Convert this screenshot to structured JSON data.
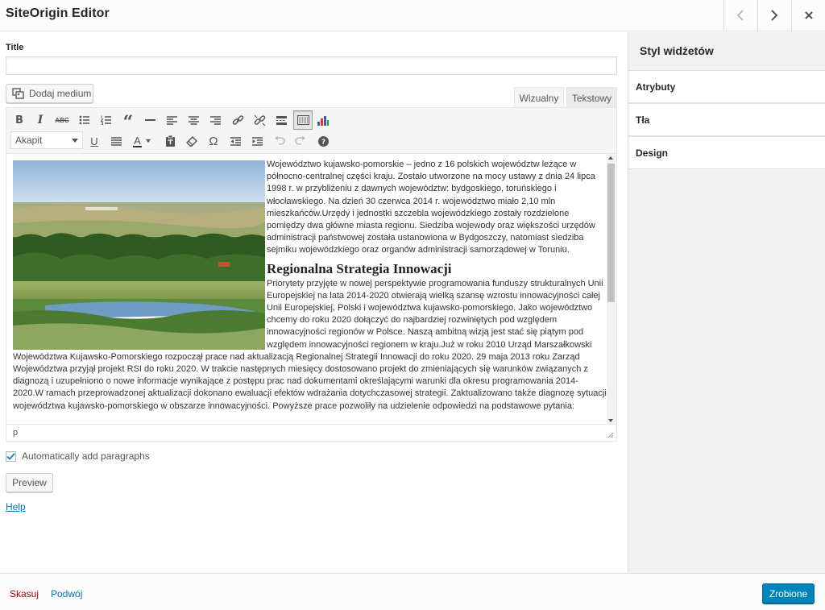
{
  "header": {
    "title": "SiteOrigin Editor",
    "prev_icon": "chevron-left-icon",
    "next_icon": "chevron-right-icon",
    "close_icon": "close-icon"
  },
  "sidebar": {
    "title": "Styl widżetów",
    "items": [
      {
        "label": "Atrybuty"
      },
      {
        "label": "Tła"
      },
      {
        "label": "Design"
      }
    ]
  },
  "form": {
    "title_label": "Title",
    "title_value": "",
    "add_media_label": "Dodaj medium",
    "tabs": [
      {
        "label": "Wizualny",
        "active": true
      },
      {
        "label": "Tekstowy",
        "active": false
      }
    ]
  },
  "toolbar": {
    "row1": [
      "bold-icon",
      "italic-icon",
      "strikethrough-icon",
      "bullet-list-icon",
      "numbered-list-icon",
      "blockquote-icon",
      "horizontal-line-icon",
      "align-left-icon",
      "align-center-icon",
      "align-right-icon",
      "insert-link-icon",
      "remove-link-icon",
      "read-more-icon",
      "toolbar-toggle-icon",
      "chart-icon"
    ],
    "format_select": "Akapit",
    "row2": [
      "underline-icon",
      "justify-icon",
      "text-color-icon",
      "paste-text-icon",
      "clear-formatting-icon",
      "special-character-icon",
      "outdent-icon",
      "indent-icon",
      "undo-icon",
      "redo-icon",
      "help-icon"
    ]
  },
  "content": {
    "intro": "Województwo kujawsko-pomorskie – jedno z 16 polskich województw leżące w północno-centralnej części kraju. Zostało utworzone na mocy ustawy z dnia 24 lipca 1998 r. w przybliżeniu z dawnych województw: bydgoskiego, toruńskiego i włocławskiego. Na dzień 30 czerwca 2014 r. województwo miało 2,10 mln mieszkańców.Urzędy i jednostki szczebla wojewódzkiego zostały rozdzielone pomiędzy dwa główne miasta regionu. Siedziba wojewody oraz większości urzędów administracji państwowej została ustanowiona w Bydgoszczy, natomiast siedziba sejmiku wojewódzkiego oraz organów administracji samorządowej w Toruniu.",
    "heading": "Regionalna Strategia Innowacji",
    "body": "Priorytety przyjęte w nowej perspektywie programowania funduszy strukturalnych Unii Europejskiej na lata 2014-2020 otwierają wielką szansę wzrostu innowacyjności całej Unii Europejskiej, Polski i województwa kujawsko-pomorskiego. Jako województwo chcemy do roku 2020 dołączyć do najbardziej rozwiniętych pod względem innowacyjności regionów w Polsce. Naszą ambitną wizją jest stać się piątym pod względem innowacyjności regionem w kraju.Już w roku 2010 Urząd Marszałkowski Województwa Kujawsko-Pomorskiego rozpoczął prace nad aktualizacją Regionalnej Strategii Innowacji do roku 2020. 29 maja 2013 roku Zarząd Województwa przyjął projekt RSI do roku 2020. W trakcie następnych miesięcy dostosowano projekt do zmieniających się warunków związanych z diagnozą i uzupełniono o nowe informacje wynikające z postępu prac nad dokumentami określającymi warunki dla okresu programowania 2014-2020.W ramach przeprowadzonej aktualizacji dokonano ewaluacji efektów wdrażania dotychczasowej strategii. Zaktualizowano także diagnozę sytuacji województwa kujawsko-pomorskiego w obszarze innowacyjności. Powyższe prace pozwoliły na udzielenie odpowiedzi na podstawowe pytania:",
    "status_path": "p"
  },
  "options": {
    "auto_paragraphs_label": "Automatically add paragraphs",
    "auto_paragraphs_checked": true,
    "preview_label": "Preview",
    "help_label": "Help"
  },
  "footer": {
    "cancel_label": "Skasuj",
    "duplicate_label": "Podwój",
    "done_label": "Zrobione"
  },
  "colors": {
    "primary": "#0085ba",
    "link": "#0073aa",
    "danger": "#a00"
  }
}
